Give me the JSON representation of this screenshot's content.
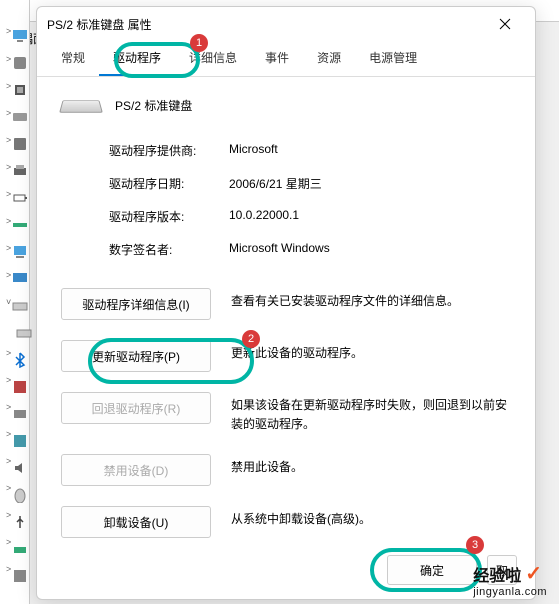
{
  "background": {
    "partial_text": "偶面"
  },
  "dialog": {
    "title": "PS/2 标准键盘 属性",
    "tabs": [
      "常规",
      "驱动程序",
      "详细信息",
      "事件",
      "资源",
      "电源管理"
    ],
    "active_tab_index": 1,
    "device_name": "PS/2 标准键盘",
    "info": {
      "provider_label": "驱动程序提供商:",
      "provider_value": "Microsoft",
      "date_label": "驱动程序日期:",
      "date_value": "2006/6/21 星期三",
      "version_label": "驱动程序版本:",
      "version_value": "10.0.22000.1",
      "signer_label": "数字签名者:",
      "signer_value": "Microsoft Windows"
    },
    "actions": {
      "details_label": "驱动程序详细信息(I)",
      "details_desc": "查看有关已安装驱动程序文件的详细信息。",
      "update_label": "更新驱动程序(P)",
      "update_desc": "更新此设备的驱动程序。",
      "rollback_label": "回退驱动程序(R)",
      "rollback_desc": "如果该设备在更新驱动程序时失败，则回退到以前安装的驱动程序。",
      "disable_label": "禁用设备(D)",
      "disable_desc": "禁用此设备。",
      "uninstall_label": "卸载设备(U)",
      "uninstall_desc": "从系统中卸载设备(高级)。"
    },
    "footer": {
      "ok": "确定",
      "cancel": "取"
    }
  },
  "annotations": {
    "b1": "1",
    "b2": "2",
    "b3": "3"
  },
  "watermark": {
    "line1": "经验啦",
    "line2": "jingyanla.com"
  }
}
